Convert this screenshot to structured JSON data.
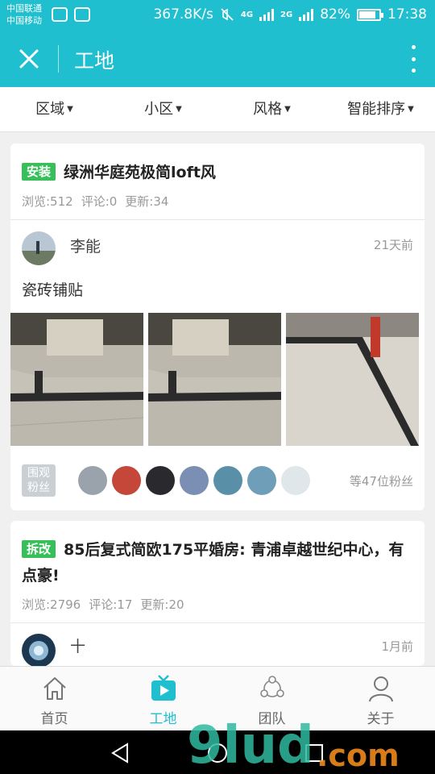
{
  "status_bar": {
    "carrier1": "中国联通",
    "carrier2": "中国移动",
    "speed": "367.8K/s",
    "net1": "4G",
    "net2": "2G",
    "battery": "82%",
    "battery_level": 0.82,
    "time": "17:38"
  },
  "app_bar": {
    "title": "工地"
  },
  "filters": [
    "区域",
    "小区",
    "风格",
    "智能排序"
  ],
  "posts": [
    {
      "badge": "安装",
      "title": "绿洲华庭苑极简loft风",
      "views": "浏览:512",
      "comments": "评论:0",
      "updates": "更新:34",
      "author": "李能",
      "time": "21天前",
      "text": "瓷砖铺贴",
      "fans_label_1": "围观",
      "fans_label_2": "粉丝",
      "fans_count": "等47位粉丝"
    },
    {
      "badge": "拆改",
      "title": "85后复式简欧175平婚房: 青浦卓越世纪中心，有点豪!",
      "views": "浏览:2796",
      "comments": "评论:17",
      "updates": "更新:20",
      "author": "十",
      "time": "1月前"
    }
  ],
  "nav": [
    "首页",
    "工地",
    "团队",
    "关于"
  ],
  "watermark": ".com",
  "colors": {
    "accent": "#1fbfcf",
    "badge_green": "#37c05a"
  }
}
